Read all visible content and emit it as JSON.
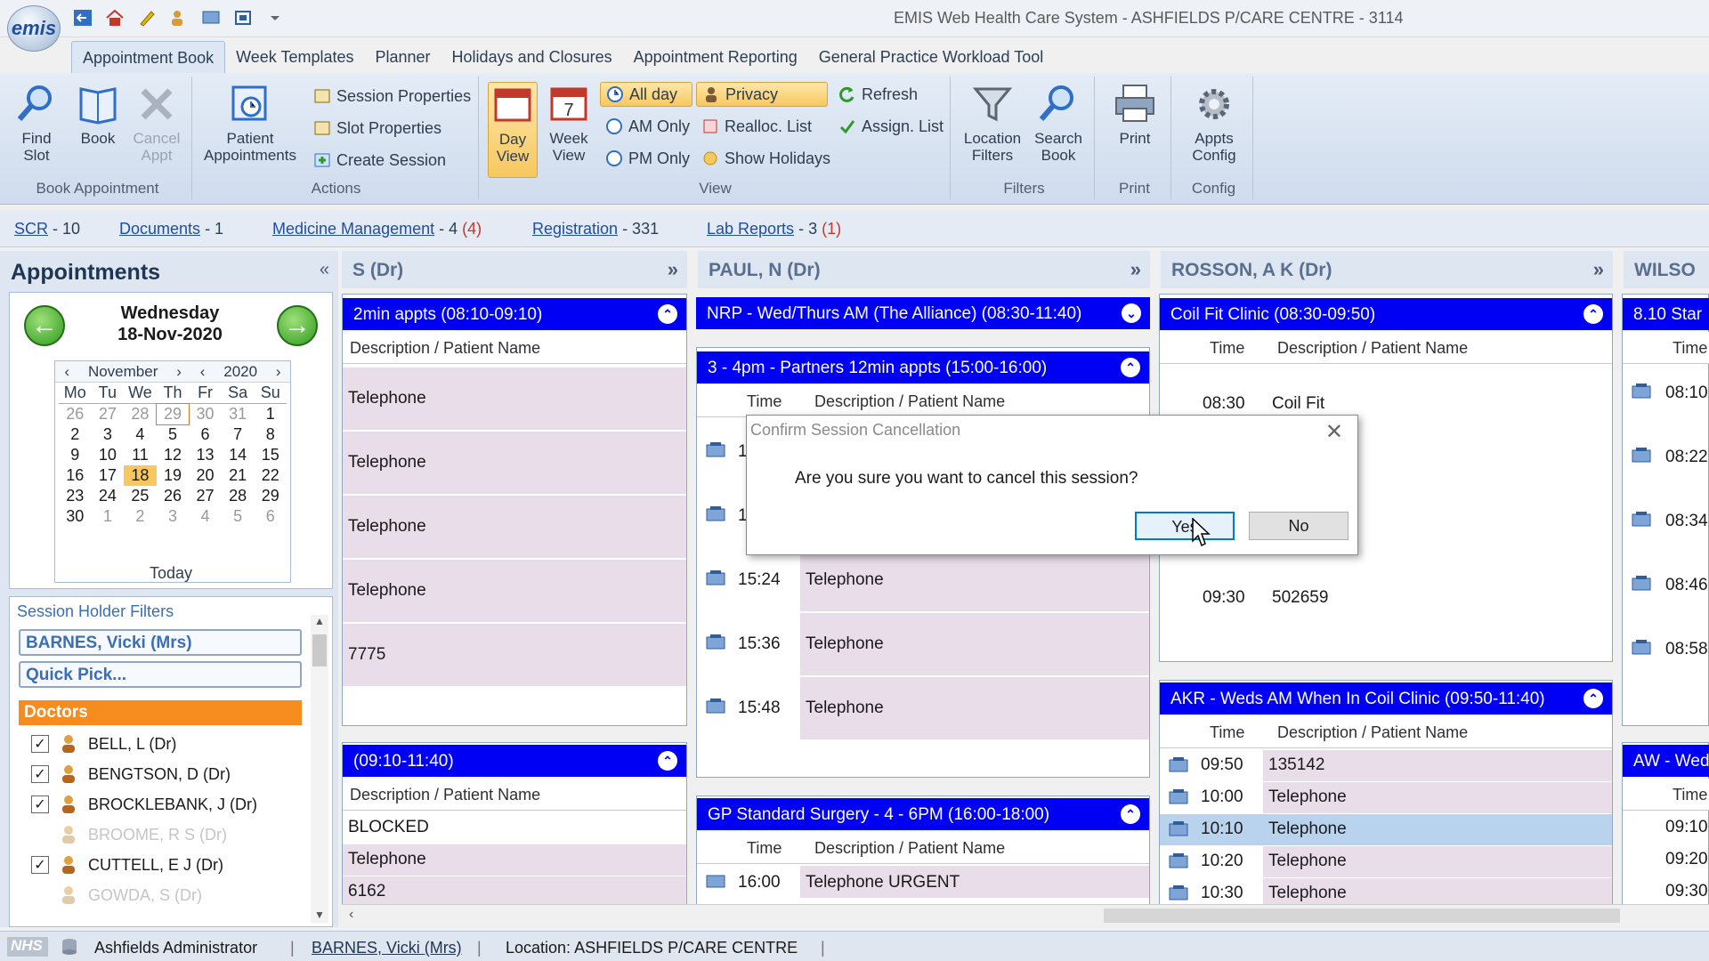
{
  "window": {
    "title": "EMIS Web Health Care System - ASHFIELDS P/CARE CENTRE - 3114",
    "logo": "emis"
  },
  "menu_tabs": [
    "Appointment Book",
    "Week Templates",
    "Planner",
    "Holidays and Closures",
    "Appointment Reporting",
    "General Practice Workload Tool"
  ],
  "ribbon": {
    "book_appointment": {
      "label": "Book Appointment",
      "find_slot": "Find Slot",
      "book": "Book",
      "cancel_appt": "Cancel Appt"
    },
    "actions": {
      "label": "Actions",
      "patient_appointments": "Patient Appointments",
      "session_properties": "Session Properties",
      "slot_properties": "Slot Properties",
      "create_session": "Create Session"
    },
    "view": {
      "label": "View",
      "day_view": "Day View",
      "week_view": "Week View",
      "all_day": "All day",
      "am_only": "AM Only",
      "pm_only": "PM Only",
      "privacy": "Privacy",
      "realloc_list": "Realloc. List",
      "show_holidays": "Show Holidays",
      "refresh": "Refresh",
      "assign_list": "Assign. List"
    },
    "filters": {
      "label": "Filters",
      "location_filters": "Location Filters",
      "search_book": "Search Book"
    },
    "print": {
      "label": "Print",
      "print": "Print"
    },
    "config": {
      "label": "Config",
      "appts_config": "Appts Config"
    }
  },
  "links": [
    {
      "name": "SCR",
      "count": "- 10",
      "red": ""
    },
    {
      "name": "Documents",
      "count": "- 1",
      "red": ""
    },
    {
      "name": "Medicine Management",
      "count": "- 4",
      "red": "(4)"
    },
    {
      "name": "Registration",
      "count": "- 331",
      "red": ""
    },
    {
      "name": "Lab Reports",
      "count": "- 3",
      "red": "(1)"
    }
  ],
  "appointments_panel": {
    "title": "Appointments",
    "collapse": "«",
    "day": "Wednesday",
    "date": "18-Nov-2020",
    "calendar": {
      "month": "November",
      "year": "2020",
      "weekdays": [
        "Mo",
        "Tu",
        "We",
        "Th",
        "Fr",
        "Sa",
        "Su"
      ],
      "weeks": [
        [
          "26",
          "27",
          "28",
          "29",
          "30",
          "31",
          "1"
        ],
        [
          "2",
          "3",
          "4",
          "5",
          "6",
          "7",
          "8"
        ],
        [
          "9",
          "10",
          "11",
          "12",
          "13",
          "14",
          "15"
        ],
        [
          "16",
          "17",
          "18",
          "19",
          "20",
          "21",
          "22"
        ],
        [
          "23",
          "24",
          "25",
          "26",
          "27",
          "28",
          "29"
        ],
        [
          "30",
          "1",
          "2",
          "3",
          "4",
          "5",
          "6"
        ]
      ],
      "today_label": "Today"
    },
    "filters_title": "Session Holder Filters",
    "selected_holder": "BARNES, Vicki (Mrs)",
    "quick_pick": "Quick Pick...",
    "doctors_header": "Doctors",
    "doctors": [
      {
        "name": "BELL, L (Dr)",
        "checked": true,
        "enabled": true
      },
      {
        "name": "BENGTSON, D (Dr)",
        "checked": true,
        "enabled": true
      },
      {
        "name": "BROCKLEBANK, J (Dr)",
        "checked": true,
        "enabled": true
      },
      {
        "name": "BROOME, R S (Dr)",
        "checked": false,
        "enabled": false
      },
      {
        "name": "CUTTELL, E J (Dr)",
        "checked": true,
        "enabled": true
      },
      {
        "name": "GOWDA, S (Dr)",
        "checked": false,
        "enabled": false
      }
    ]
  },
  "columns": {
    "col1": {
      "header": "S (Dr)",
      "session1": "2min appts (08:10-09:10)",
      "desc_header": "Description / Patient Name",
      "slots1": [
        "Telephone",
        "Telephone",
        "Telephone",
        "Telephone",
        "7775"
      ],
      "session2": "(09:10-11:40)",
      "slots2": [
        "BLOCKED",
        "Telephone",
        "6162"
      ]
    },
    "col2": {
      "header": "PAUL, N (Dr)",
      "session1": "NRP - Wed/Thurs AM (The Alliance) (08:30-11:40)",
      "session2": "3 - 4pm - Partners 12min appts (15:00-16:00)",
      "time_header": "Time",
      "desc_header": "Description / Patient Name",
      "slots": [
        {
          "time": "1",
          "desc": ""
        },
        {
          "time": "1",
          "desc": ""
        },
        {
          "time": "15:24",
          "desc": "Telephone"
        },
        {
          "time": "15:36",
          "desc": "Telephone"
        },
        {
          "time": "15:48",
          "desc": "Telephone"
        }
      ],
      "session3": "GP Standard Surgery - 4 - 6PM (16:00-18:00)",
      "slots3": [
        {
          "time": "16:00",
          "desc": "Telephone URGENT"
        }
      ]
    },
    "col3": {
      "header": "ROSSON, A K (Dr)",
      "session1": "Coil Fit Clinic (08:30-09:50)",
      "time_header": "Time",
      "desc_header": "Description / Patient Name",
      "slots1": [
        {
          "time": "08:30",
          "desc": "Coil Fit"
        },
        {
          "time": "09:30",
          "desc": "502659"
        }
      ],
      "session2": "AKR - Weds AM When In Coil Clinic (09:50-11:40)",
      "slots2": [
        {
          "time": "09:50",
          "desc": "135142"
        },
        {
          "time": "10:00",
          "desc": "Telephone"
        },
        {
          "time": "10:10",
          "desc": "Telephone"
        },
        {
          "time": "10:20",
          "desc": "Telephone"
        },
        {
          "time": "10:30",
          "desc": "Telephone"
        }
      ]
    },
    "col4": {
      "header": "WILSO",
      "session1": "8.10 Star",
      "time_header": "Time",
      "times1": [
        "08:10",
        "08:22",
        "08:34",
        "08:46",
        "08:58"
      ],
      "session2": "AW - Wed",
      "times2": [
        "09:10",
        "09:20",
        "09:30"
      ]
    }
  },
  "dialog": {
    "title": "Confirm Session Cancellation",
    "message": "Are you sure you want to cancel this session?",
    "yes": "Yes",
    "no": "No"
  },
  "status": {
    "nhs": "NHS",
    "user": "Ashfields Administrator",
    "holder": "BARNES, Vicki (Mrs)",
    "location": "Location:  ASHFIELDS P/CARE CENTRE"
  },
  "colors": {
    "session_header": "#0000f5",
    "slot_bg": "#e8dde8",
    "selected_slot": "#b9d3ef",
    "doctors_header": "#f68b1e",
    "link": "#1f4ea5"
  }
}
